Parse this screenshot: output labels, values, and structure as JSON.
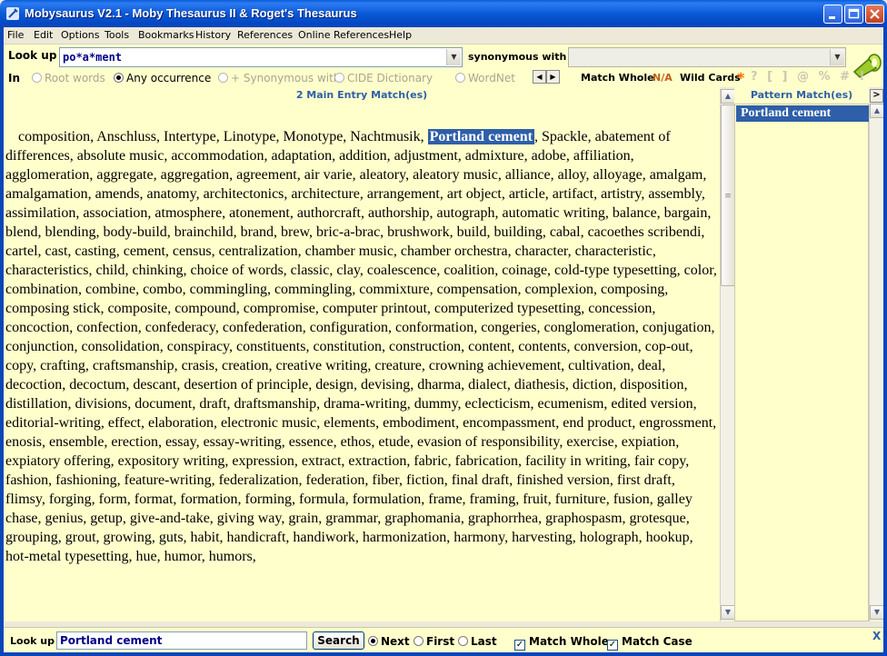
{
  "window": {
    "title": "Mobysaurus V2.1 - Moby Thesaurus II & Roget's Thesaurus"
  },
  "menu": [
    "File",
    "Edit",
    "Options",
    "Tools",
    "Bookmarks",
    "History",
    "References",
    "Online References",
    "Help"
  ],
  "toolbar": {
    "lookup_label": "Look up",
    "lookup_value": "po*a*ment",
    "synonymous_label": "synonymous with",
    "synonymous_value": "",
    "in_label": "In",
    "radios": [
      {
        "label": "Root words",
        "checked": false,
        "disabled": true
      },
      {
        "label": "Any occurrence",
        "checked": true,
        "disabled": false
      },
      {
        "label": "+ Synonymous with",
        "checked": false,
        "disabled": true
      },
      {
        "label": "CIDE Dictionary",
        "checked": false,
        "disabled": true
      },
      {
        "label": "WordNet",
        "checked": false,
        "disabled": true
      }
    ],
    "match_whole_label": "Match Whole",
    "match_whole_value": "N/A",
    "wild_cards_label": "Wild Cards",
    "wild_star": "*",
    "wild_others": "? [ ] @ % # !"
  },
  "main": {
    "header": "2 Main Entry Match(es)",
    "before": "composition, Anschluss, Intertype, Linotype, Monotype, Nachtmusik, ",
    "highlight": "Portland cement",
    "after": ", Spackle, abatement of differences, absolute music, accommodation, adaptation, addition, adjustment, admixture, adobe, affiliation, agglomeration, aggregate, aggregation, agreement, air varie, aleatory, aleatory music, alliance, alloy, alloyage, amalgam, amalgamation, amends, anatomy, architectonics, architecture, arrangement, art object, article, artifact, artistry, assembly, assimilation, association, atmosphere, atonement, authorcraft, authorship, autograph, automatic writing, balance, bargain, blend, blending, body-build, brainchild, brand, brew, bric-a-brac, brushwork, build, building, cabal, cacoethes scribendi, cartel, cast, casting, cement, census, centralization, chamber music, chamber orchestra, character, characteristic, characteristics, child, chinking, choice of words, classic, clay, coalescence, coalition, coinage, cold-type typesetting, color, combination, combine, combo, commingling, commingling, commixture, compensation, complexion, composing, composing stick, composite, compound, compromise, computer printout, computerized typesetting, concession, concoction, confection, confederacy, confederation, configuration, conformation, congeries, conglomeration, conjugation, conjunction, consolidation, conspiracy, constituents, constitution, construction, content, contents, conversion, cop-out, copy, crafting, craftsmanship, crasis, creation, creative writing, creature, crowning achievement, cultivation, deal, decoction, decoctum, descant, desertion of principle, design, devising, dharma, dialect, diathesis, diction, disposition, distillation, divisions, document, draft, draftsmanship, drama-writing, dummy, eclecticism, ecumenism, edited version, editorial-writing, effect, elaboration, electronic music, elements, embodiment, encompassment, end product, engrossment, enosis, ensemble, erection, essay, essay-writing, essence, ethos, etude, evasion of responsibility, exercise, expiation, expiatory offering, expository writing, expression, extract, extraction, fabric, fabrication, facility in writing, fair copy, fashion, fashioning, feature-writing, federalization, federation, fiber, fiction, final draft, finished version, first draft, flimsy, forging, form, format, formation, forming, formula, formulation, frame, framing, fruit, furniture, fusion, galley chase, genius, getup, give-and-take, giving way, grain, grammar, graphomania, graphorrhea, graphospasm, grotesque, grouping, grout, growing, guts, habit, handicraft, handiwork, harmonization, harmony, harvesting, holograph, hookup, hot-metal typesetting, hue, humor, humors,"
  },
  "side": {
    "header": "Pattern Match(es)",
    "expand": ">",
    "items": [
      "Portland cement"
    ]
  },
  "find": {
    "label": "Look up",
    "value": "Portland cement",
    "button": "Search",
    "next": "Next",
    "first": "First",
    "last": "Last",
    "match_whole": "Match Whole",
    "match_case": "Match Case",
    "close": "X"
  }
}
